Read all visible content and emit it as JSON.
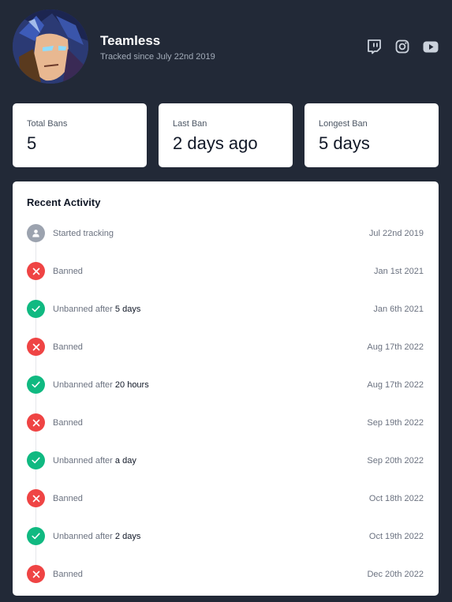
{
  "profile": {
    "name": "Teamless",
    "tracked_since": "Tracked since July 22nd 2019",
    "socials": [
      {
        "icon": "twitch-icon"
      },
      {
        "icon": "instagram-icon"
      },
      {
        "icon": "youtube-icon"
      }
    ]
  },
  "stats": [
    {
      "label": "Total Bans",
      "value": "5"
    },
    {
      "label": "Last Ban",
      "value": "2 days ago"
    },
    {
      "label": "Longest Ban",
      "value": "5 days"
    }
  ],
  "activity": {
    "title": "Recent Activity",
    "events": [
      {
        "type": "neutral",
        "icon": "user-icon",
        "text": "Started tracking",
        "emphasis": "",
        "date": "Jul 22nd 2019"
      },
      {
        "type": "banned",
        "icon": "x-icon",
        "text": "Banned",
        "emphasis": "",
        "date": "Jan 1st 2021"
      },
      {
        "type": "unbanned",
        "icon": "check-icon",
        "text": "Unbanned after",
        "emphasis": "5 days",
        "date": "Jan 6th 2021"
      },
      {
        "type": "banned",
        "icon": "x-icon",
        "text": "Banned",
        "emphasis": "",
        "date": "Aug 17th 2022"
      },
      {
        "type": "unbanned",
        "icon": "check-icon",
        "text": "Unbanned after",
        "emphasis": "20 hours",
        "date": "Aug 17th 2022"
      },
      {
        "type": "banned",
        "icon": "x-icon",
        "text": "Banned",
        "emphasis": "",
        "date": "Sep 19th 2022"
      },
      {
        "type": "unbanned",
        "icon": "check-icon",
        "text": "Unbanned after",
        "emphasis": "a day",
        "date": "Sep 20th 2022"
      },
      {
        "type": "banned",
        "icon": "x-icon",
        "text": "Banned",
        "emphasis": "",
        "date": "Oct 18th 2022"
      },
      {
        "type": "unbanned",
        "icon": "check-icon",
        "text": "Unbanned after",
        "emphasis": "2 days",
        "date": "Oct 19th 2022"
      },
      {
        "type": "banned",
        "icon": "x-icon",
        "text": "Banned",
        "emphasis": "",
        "date": "Dec 20th 2022"
      }
    ]
  },
  "colors": {
    "background": "#222937",
    "card": "#ffffff",
    "banned": "#ef4444",
    "unbanned": "#10b981",
    "neutral": "#9ca3af"
  }
}
